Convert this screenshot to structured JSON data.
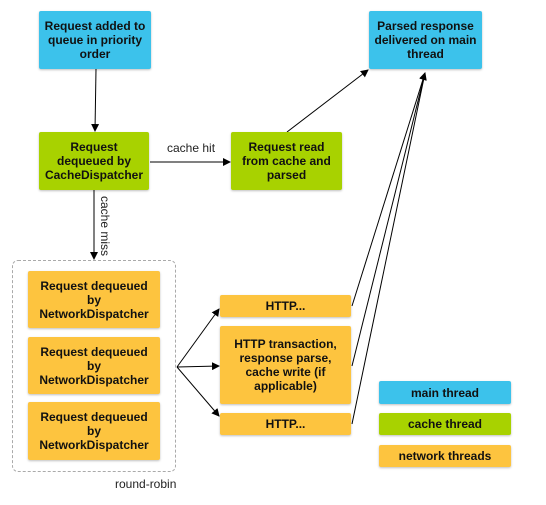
{
  "colors": {
    "main_thread": "#3cc2eb",
    "cache_thread": "#a8d200",
    "network_threads": "#fdc43f"
  },
  "nodes": {
    "queued": "Request added to queue in priority order",
    "delivered": "Parsed response delivered on main thread",
    "cache_dispatcher": "Request dequeued by CacheDispatcher",
    "cache_read": "Request read from cache and parsed",
    "network": [
      "Request dequeued by NetworkDispatcher",
      "Request dequeued by NetworkDispatcher",
      "Request dequeued by NetworkDispatcher"
    ],
    "http_short_1": "HTTP...",
    "http_full": "HTTP transaction, response parse, cache write (if applicable)",
    "http_short_2": "HTTP..."
  },
  "edge_labels": {
    "cache_hit": "cache hit",
    "cache_miss": "cache miss",
    "round_robin": "round-robin"
  },
  "legend": [
    "main thread",
    "cache thread",
    "network threads"
  ]
}
